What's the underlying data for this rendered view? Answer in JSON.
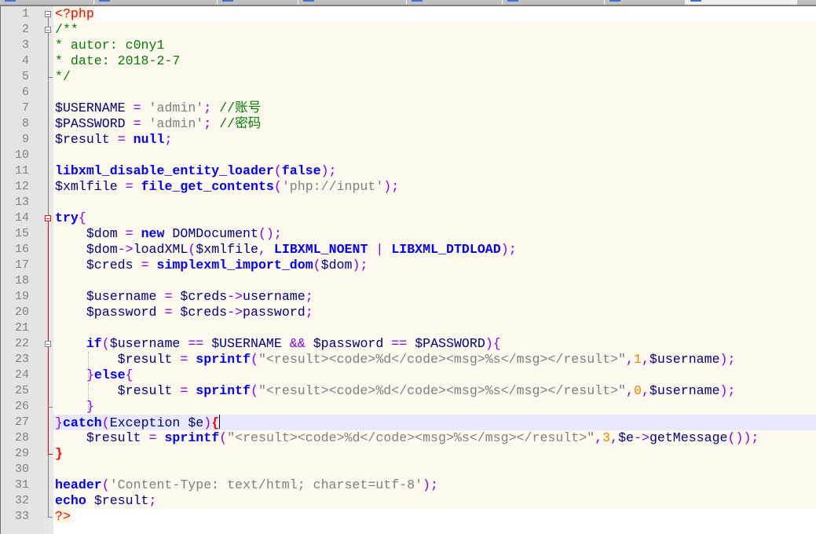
{
  "tabbar": {
    "tabs": [
      {
        "active": false
      },
      {
        "active": false
      },
      {
        "active": false
      },
      {
        "active": false
      },
      {
        "active": false
      },
      {
        "active": false
      },
      {
        "active": false
      },
      {
        "active": true
      }
    ]
  },
  "editor": {
    "language": "php",
    "current_line": 27,
    "colors": {
      "php_tag": "#ff0000",
      "comment": "#008000",
      "variable": "#000080",
      "operator": "#8000ff",
      "string": "#808080",
      "function": "#0000ff",
      "number": "#ff8000",
      "current_line_bg": "#e8e8ff",
      "brace_match": "#ff0000"
    },
    "lines": [
      {
        "n": "1",
        "tokens": [
          [
            "tag",
            "<?php"
          ]
        ]
      },
      {
        "n": "2",
        "tokens": [
          [
            "com",
            "/**"
          ]
        ]
      },
      {
        "n": "3",
        "tokens": [
          [
            "com",
            "* autor: c0ny1"
          ]
        ]
      },
      {
        "n": "4",
        "tokens": [
          [
            "com",
            "* date: 2018-2-7"
          ]
        ]
      },
      {
        "n": "5",
        "tokens": [
          [
            "com",
            "*/"
          ]
        ]
      },
      {
        "n": "6",
        "tokens": []
      },
      {
        "n": "7",
        "tokens": [
          [
            "var",
            "$USERNAME"
          ],
          [
            "plain",
            " "
          ],
          [
            "op",
            "="
          ],
          [
            "plain",
            " "
          ],
          [
            "str",
            "'admin'"
          ],
          [
            "op",
            ";"
          ],
          [
            "plain",
            " "
          ],
          [
            "com",
            "//账号"
          ]
        ]
      },
      {
        "n": "8",
        "tokens": [
          [
            "var",
            "$PASSWORD"
          ],
          [
            "plain",
            " "
          ],
          [
            "op",
            "="
          ],
          [
            "plain",
            " "
          ],
          [
            "str",
            "'admin'"
          ],
          [
            "op",
            ";"
          ],
          [
            "plain",
            " "
          ],
          [
            "com",
            "//密码"
          ]
        ]
      },
      {
        "n": "9",
        "tokens": [
          [
            "var",
            "$result"
          ],
          [
            "plain",
            " "
          ],
          [
            "op",
            "="
          ],
          [
            "plain",
            " "
          ],
          [
            "kw",
            "null"
          ],
          [
            "op",
            ";"
          ]
        ]
      },
      {
        "n": "10",
        "tokens": []
      },
      {
        "n": "11",
        "tokens": [
          [
            "fn",
            "libxml_disable_entity_loader"
          ],
          [
            "op",
            "("
          ],
          [
            "kw",
            "false"
          ],
          [
            "op",
            ");"
          ]
        ]
      },
      {
        "n": "12",
        "tokens": [
          [
            "var",
            "$xmlfile"
          ],
          [
            "plain",
            " "
          ],
          [
            "op",
            "="
          ],
          [
            "plain",
            " "
          ],
          [
            "fn",
            "file_get_contents"
          ],
          [
            "op",
            "("
          ],
          [
            "str",
            "'php://input'"
          ],
          [
            "op",
            ");"
          ]
        ]
      },
      {
        "n": "13",
        "tokens": []
      },
      {
        "n": "14",
        "tokens": [
          [
            "kw",
            "try"
          ],
          [
            "op",
            "{"
          ]
        ]
      },
      {
        "n": "15",
        "tokens": [
          [
            "plain",
            "    "
          ],
          [
            "var",
            "$dom"
          ],
          [
            "plain",
            " "
          ],
          [
            "op",
            "="
          ],
          [
            "plain",
            " "
          ],
          [
            "kw",
            "new"
          ],
          [
            "plain",
            " DOMDocument"
          ],
          [
            "op",
            "();"
          ]
        ]
      },
      {
        "n": "16",
        "tokens": [
          [
            "plain",
            "    "
          ],
          [
            "var",
            "$dom"
          ],
          [
            "op",
            "->"
          ],
          [
            "plain",
            "loadXML"
          ],
          [
            "op",
            "("
          ],
          [
            "var",
            "$xmlfile"
          ],
          [
            "op",
            ","
          ],
          [
            "plain",
            " "
          ],
          [
            "kw",
            "LIBXML_NOENT"
          ],
          [
            "plain",
            " "
          ],
          [
            "op",
            "|"
          ],
          [
            "plain",
            " "
          ],
          [
            "kw",
            "LIBXML_DTDLOAD"
          ],
          [
            "op",
            ");"
          ]
        ]
      },
      {
        "n": "17",
        "tokens": [
          [
            "plain",
            "    "
          ],
          [
            "var",
            "$creds"
          ],
          [
            "plain",
            " "
          ],
          [
            "op",
            "="
          ],
          [
            "plain",
            " "
          ],
          [
            "fn",
            "simplexml_import_dom"
          ],
          [
            "op",
            "("
          ],
          [
            "var",
            "$dom"
          ],
          [
            "op",
            ");"
          ]
        ]
      },
      {
        "n": "18",
        "tokens": []
      },
      {
        "n": "19",
        "tokens": [
          [
            "plain",
            "    "
          ],
          [
            "var",
            "$username"
          ],
          [
            "plain",
            " "
          ],
          [
            "op",
            "="
          ],
          [
            "plain",
            " "
          ],
          [
            "var",
            "$creds"
          ],
          [
            "op",
            "->"
          ],
          [
            "plain",
            "username"
          ],
          [
            "op",
            ";"
          ]
        ]
      },
      {
        "n": "20",
        "tokens": [
          [
            "plain",
            "    "
          ],
          [
            "var",
            "$password"
          ],
          [
            "plain",
            " "
          ],
          [
            "op",
            "="
          ],
          [
            "plain",
            " "
          ],
          [
            "var",
            "$creds"
          ],
          [
            "op",
            "->"
          ],
          [
            "plain",
            "password"
          ],
          [
            "op",
            ";"
          ]
        ]
      },
      {
        "n": "21",
        "tokens": []
      },
      {
        "n": "22",
        "tokens": [
          [
            "plain",
            "    "
          ],
          [
            "kw",
            "if"
          ],
          [
            "op",
            "("
          ],
          [
            "var",
            "$username"
          ],
          [
            "plain",
            " "
          ],
          [
            "op",
            "=="
          ],
          [
            "plain",
            " "
          ],
          [
            "var",
            "$USERNAME"
          ],
          [
            "plain",
            " "
          ],
          [
            "op",
            "&&"
          ],
          [
            "plain",
            " "
          ],
          [
            "var",
            "$password"
          ],
          [
            "plain",
            " "
          ],
          [
            "op",
            "=="
          ],
          [
            "plain",
            " "
          ],
          [
            "var",
            "$PASSWORD"
          ],
          [
            "op",
            "){"
          ]
        ]
      },
      {
        "n": "23",
        "tokens": [
          [
            "plain",
            "        "
          ],
          [
            "var",
            "$result"
          ],
          [
            "plain",
            " "
          ],
          [
            "op",
            "="
          ],
          [
            "plain",
            " "
          ],
          [
            "fn",
            "sprintf"
          ],
          [
            "op",
            "("
          ],
          [
            "str",
            "\"<result><code>%d</code><msg>%s</msg></result>\""
          ],
          [
            "op",
            ","
          ],
          [
            "num",
            "1"
          ],
          [
            "op",
            ","
          ],
          [
            "var",
            "$username"
          ],
          [
            "op",
            ");"
          ]
        ]
      },
      {
        "n": "24",
        "tokens": [
          [
            "plain",
            "    "
          ],
          [
            "op",
            "}"
          ],
          [
            "kw",
            "else"
          ],
          [
            "op",
            "{"
          ]
        ]
      },
      {
        "n": "25",
        "tokens": [
          [
            "plain",
            "        "
          ],
          [
            "var",
            "$result"
          ],
          [
            "plain",
            " "
          ],
          [
            "op",
            "="
          ],
          [
            "plain",
            " "
          ],
          [
            "fn",
            "sprintf"
          ],
          [
            "op",
            "("
          ],
          [
            "str",
            "\"<result><code>%d</code><msg>%s</msg></result>\""
          ],
          [
            "op",
            ","
          ],
          [
            "num",
            "0"
          ],
          [
            "op",
            ","
          ],
          [
            "var",
            "$username"
          ],
          [
            "op",
            ");"
          ]
        ]
      },
      {
        "n": "26",
        "tokens": [
          [
            "plain",
            "    "
          ],
          [
            "op",
            "}"
          ]
        ]
      },
      {
        "n": "27",
        "tokens": [
          [
            "op",
            "}"
          ],
          [
            "kw",
            "catch"
          ],
          [
            "op",
            "("
          ],
          [
            "plain",
            "Exception "
          ],
          [
            "var",
            "$e"
          ],
          [
            "op",
            ")"
          ],
          [
            "brace",
            "{"
          ],
          [
            "caret",
            ""
          ]
        ]
      },
      {
        "n": "28",
        "tokens": [
          [
            "plain",
            "    "
          ],
          [
            "var",
            "$result"
          ],
          [
            "plain",
            " "
          ],
          [
            "op",
            "="
          ],
          [
            "plain",
            " "
          ],
          [
            "fn",
            "sprintf"
          ],
          [
            "op",
            "("
          ],
          [
            "str",
            "\"<result><code>%d</code><msg>%s</msg></result>\""
          ],
          [
            "op",
            ","
          ],
          [
            "num",
            "3"
          ],
          [
            "op",
            ","
          ],
          [
            "var",
            "$e"
          ],
          [
            "op",
            "->"
          ],
          [
            "plain",
            "getMessage"
          ],
          [
            "op",
            "());"
          ]
        ]
      },
      {
        "n": "29",
        "tokens": [
          [
            "brace",
            "}"
          ]
        ]
      },
      {
        "n": "30",
        "tokens": []
      },
      {
        "n": "31",
        "tokens": [
          [
            "fn",
            "header"
          ],
          [
            "op",
            "("
          ],
          [
            "str",
            "'Content-Type: text/html; charset=utf-8'"
          ],
          [
            "op",
            ");"
          ]
        ]
      },
      {
        "n": "32",
        "tokens": [
          [
            "kw",
            "echo"
          ],
          [
            "plain",
            " "
          ],
          [
            "var",
            "$result"
          ],
          [
            "op",
            ";"
          ]
        ]
      },
      {
        "n": "33",
        "tokens": [
          [
            "tag",
            "?>"
          ]
        ]
      }
    ]
  }
}
